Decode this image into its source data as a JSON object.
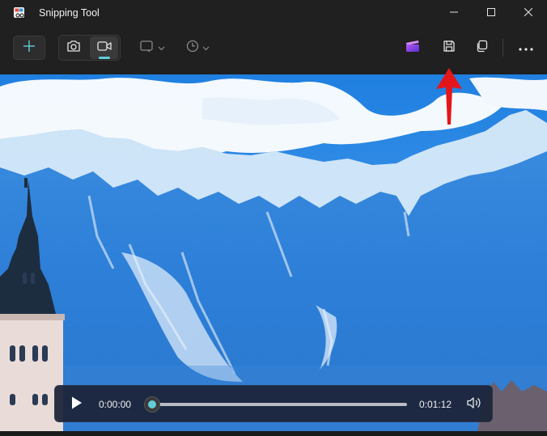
{
  "window": {
    "title": "Snipping Tool",
    "controls": {
      "minimize": "minimize-icon",
      "maximize": "maximize-icon",
      "close": "close-icon"
    }
  },
  "toolbar": {
    "new_button_icon": "plus-icon",
    "capture_modes": [
      {
        "name": "screenshot",
        "icon": "camera-icon",
        "selected": false
      },
      {
        "name": "screen-record",
        "icon": "video-camera-icon",
        "selected": true
      }
    ],
    "snip_mode_icon": "rectangle-mode-icon",
    "delay_icon": "timer-icon",
    "actions": [
      {
        "name": "clipchamp",
        "icon": "clipchamp-icon"
      },
      {
        "name": "save",
        "icon": "save-icon"
      },
      {
        "name": "copy",
        "icon": "copy-icon"
      },
      {
        "name": "more",
        "icon": "more-icon"
      }
    ],
    "accent_color": "#62cdd8"
  },
  "annotation": {
    "arrow_color": "#e3171b",
    "points_to": "save"
  },
  "player": {
    "current_time": "0:00:00",
    "total_time": "0:01:12",
    "progress": 0.0,
    "play_icon": "play-icon",
    "volume_icon": "volume-icon"
  }
}
